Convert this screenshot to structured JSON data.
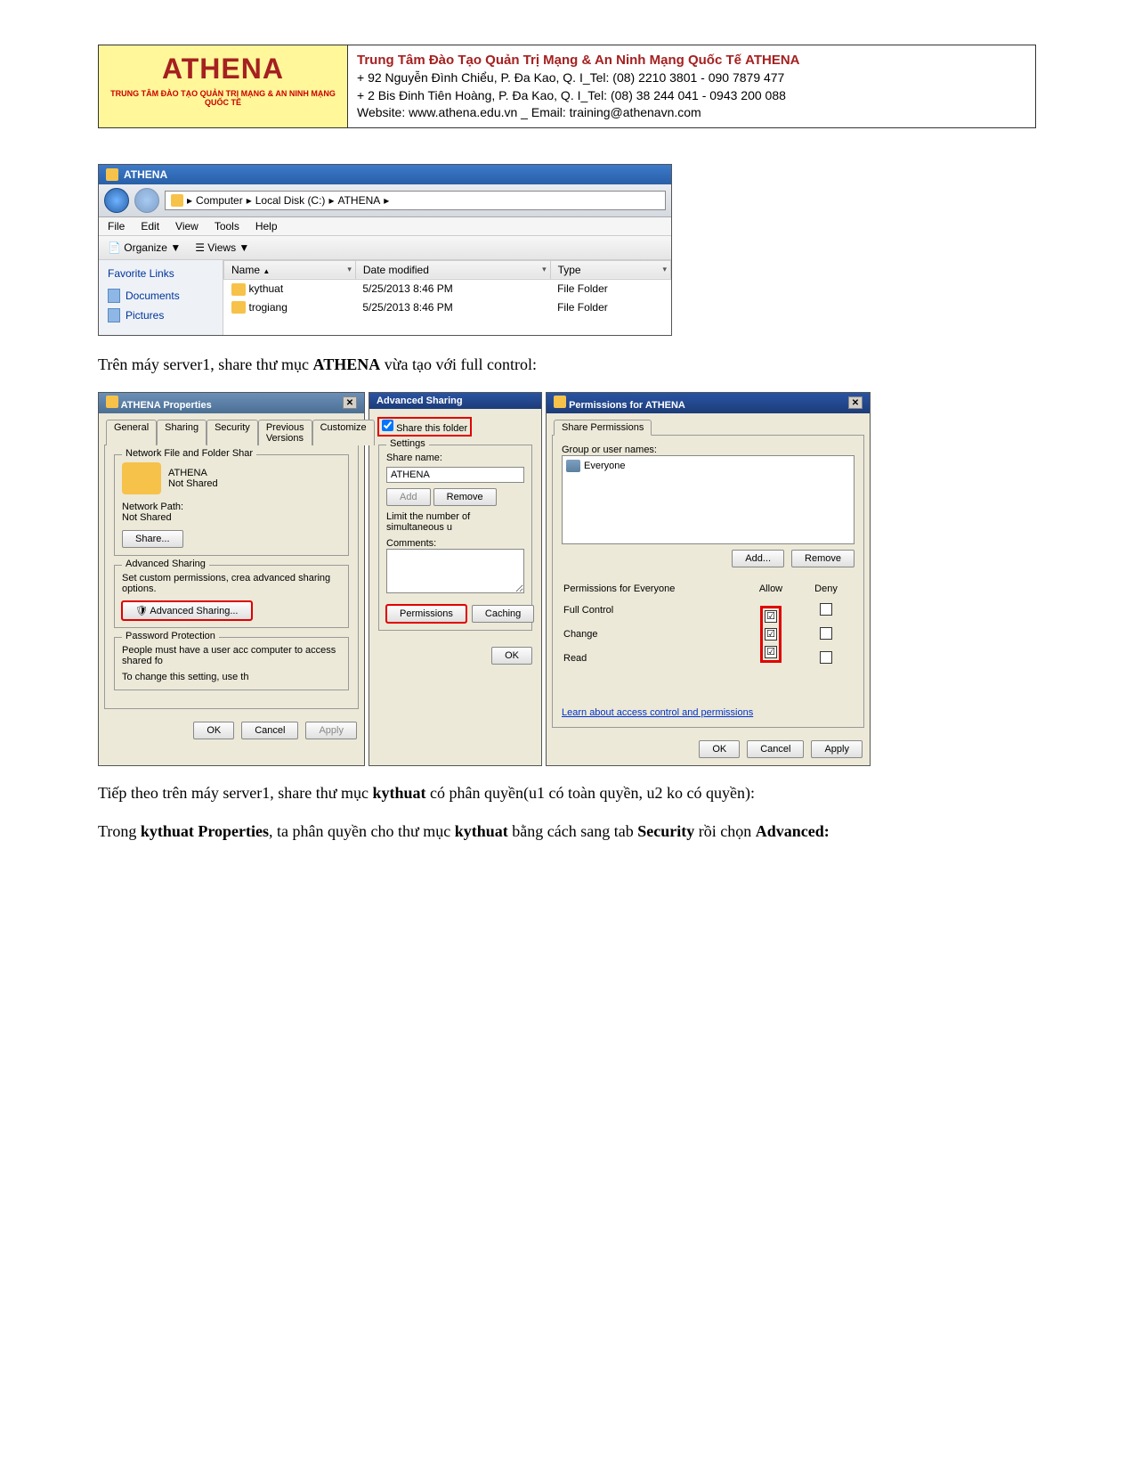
{
  "header": {
    "brand": "ATHENA",
    "tagline": "TRUNG TÂM ĐÀO TẠO QUẢN TRỊ MẠNG & AN NINH MẠNG QUỐC TẾ",
    "line1_prefix": "Trung Tâm Đào Tạo Quản Trị Mạng & An Ninh Mạng Quốc Tế",
    "line1_brand": "ATHENA",
    "line2": "+ 92 Nguyễn Đình Chiểu, P. Đa Kao, Q. I_Tel: (08) 2210 3801 -  090 7879 477",
    "line3": "+ 2 Bis Đinh Tiên Hoàng, P. Đa Kao, Q. I_Tel: (08) 38 244 041 - 0943 200 088",
    "line4": "Website: www.athena.edu.vn    _    Email: training@athenavn.com"
  },
  "explorer": {
    "title": "ATHENA",
    "breadcrumb": [
      "Computer",
      "Local Disk (C:)",
      "ATHENA"
    ],
    "menu": [
      "File",
      "Edit",
      "View",
      "Tools",
      "Help"
    ],
    "toolbar": {
      "organize": "Organize",
      "views": "Views"
    },
    "favorites_header": "Favorite Links",
    "favorites": [
      "Documents",
      "Pictures"
    ],
    "columns": [
      "Name",
      "Date modified",
      "Type"
    ],
    "rows": [
      {
        "name": "kythuat",
        "date": "5/25/2013 8:46 PM",
        "type": "File Folder"
      },
      {
        "name": "trogiang",
        "date": "5/25/2013 8:46 PM",
        "type": "File Folder"
      }
    ]
  },
  "text1_pre": "Trên máy server1, share thư mục ",
  "text1_bold": "ATHENA",
  "text1_post": " vừa tạo với full control:",
  "props_dialog": {
    "title": "ATHENA Properties",
    "tabs": [
      "General",
      "Sharing",
      "Security",
      "Previous Versions",
      "Customize"
    ],
    "active_tab": "Sharing",
    "group_network": "Network File and Folder Shar",
    "folder_name": "ATHENA",
    "folder_status": "Not Shared",
    "netpath_label": "Network Path:",
    "netpath_value": "Not Shared",
    "share_btn": "Share...",
    "group_adv": "Advanced Sharing",
    "adv_text": "Set custom permissions, crea advanced sharing options.",
    "adv_btn": "Advanced Sharing...",
    "group_pwd": "Password Protection",
    "pwd_text1": "People must have a user acc computer to access shared fo",
    "pwd_text2": "To change this setting, use th",
    "ok": "OK",
    "cancel": "Cancel",
    "apply": "Apply"
  },
  "adv_share": {
    "title": "Advanced Sharing",
    "share_folder": "Share this folder",
    "settings": "Settings",
    "share_name_label": "Share name:",
    "share_name": "ATHENA",
    "add": "Add",
    "remove": "Remove",
    "limit": "Limit the number of simultaneous u",
    "comments": "Comments:",
    "permissions": "Permissions",
    "caching": "Caching",
    "ok": "OK"
  },
  "perm_dialog": {
    "title": "Permissions for ATHENA",
    "tab": "Share Permissions",
    "group_label": "Group or user names:",
    "everyone": "Everyone",
    "add": "Add...",
    "remove": "Remove",
    "perms_for": "Permissions for Everyone",
    "allow": "Allow",
    "deny": "Deny",
    "rows": [
      "Full Control",
      "Change",
      "Read"
    ],
    "learn": "Learn about access control and permissions",
    "ok": "OK",
    "cancel": "Cancel",
    "apply": "Apply"
  },
  "text2_1": "Tiếp theo trên máy server1, share thư mục ",
  "text2_b1": "kythuat",
  "text2_2": " có phân quyền(u1 có toàn quyền, u2 ko có quyền):",
  "text3_1": "Trong ",
  "text3_b1": "kythuat Properties",
  "text3_2": ", ta phân quyền cho thư mục ",
  "text3_b2": "kythuat",
  "text3_3": " bằng cách sang tab ",
  "text3_b3": "Security",
  "text3_4": " rồi chọn ",
  "text3_b4": "Advanced:"
}
